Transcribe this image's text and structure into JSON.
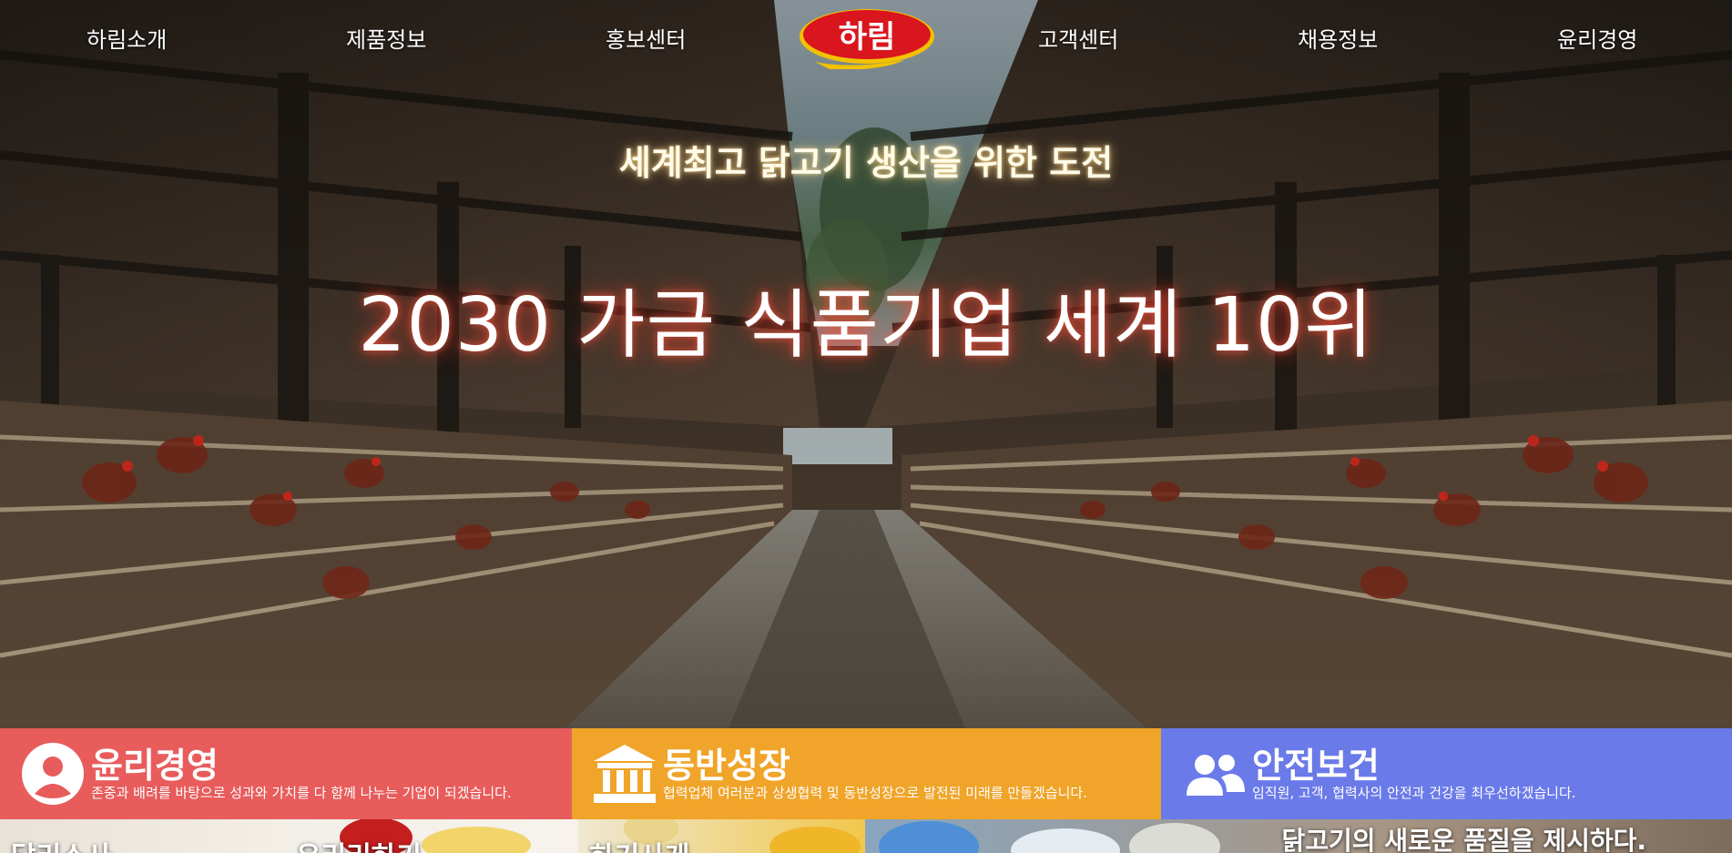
{
  "nav": {
    "items": [
      "하림소개",
      "제품정보",
      "홍보센터",
      "고객센터",
      "채용정보",
      "윤리경영"
    ],
    "logo_text": "하림"
  },
  "hero": {
    "subtitle": "세계최고 닭고기 생산을 위한 도전",
    "title": "2030 가금 식품기업 세계 10위"
  },
  "panels": [
    {
      "title": "윤리경영",
      "desc": "존중과 배려를 바탕으로 성과와 가치를 다 함께 나누는 기업이 되겠습니다.",
      "icon": "user-circle-icon",
      "color": "#e85c5c"
    },
    {
      "title": "동반성장",
      "desc": "협력업체 여러분과 상생협력 및 동반성장으로 발전된 미래를 만들겠습니다.",
      "icon": "institution-icon",
      "color": "#f0a429"
    },
    {
      "title": "안전보건",
      "desc": "임직원, 고객, 협력사의 안전과 건강을 최우선하겠습니다.",
      "icon": "people-group-icon",
      "color": "#6a7ae8"
    }
  ],
  "strip": {
    "tiles": [
      "닭리소사",
      "유리리하기",
      "하기사게"
    ],
    "caption": "닭고기의 새로운 품질을 제시하다."
  },
  "colors": {
    "logo_red": "#d9151e",
    "logo_gold": "#f2c200"
  }
}
